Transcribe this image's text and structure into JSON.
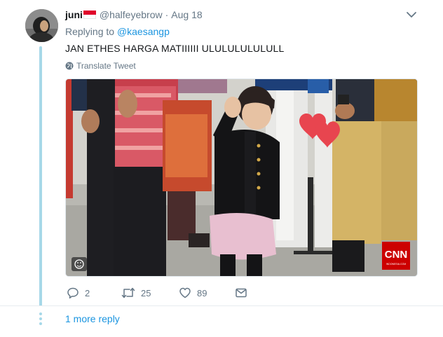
{
  "tweet": {
    "display_name": "juni",
    "handle": "@halfeyebrow",
    "separator": "·",
    "date": "Aug 18",
    "replying_prefix": "Replying to",
    "replying_to": "@kaesangp",
    "text": "JAN ETHES HARGA MATIIIIII ULULULULULULL",
    "translate_label": "Translate Tweet",
    "media": {
      "watermark_logo": "CNN",
      "watermark_sub": "INDONESIA.COM"
    },
    "actions": {
      "reply_count": "2",
      "retweet_count": "25",
      "like_count": "89"
    }
  },
  "thread": {
    "more_replies_label": "1 more reply"
  },
  "colors": {
    "link": "#1b95e0",
    "muted": "#657786",
    "thread_line": "#a6d8e8",
    "flag_red": "#e0002a",
    "cnn_red": "#cc0000",
    "heart": "#e8454f"
  },
  "icons": [
    "chevron-down-icon",
    "globe-icon",
    "reply-icon",
    "retweet-icon",
    "like-icon",
    "message-icon",
    "gif-badge-icon",
    "heart-sticker-icon"
  ]
}
